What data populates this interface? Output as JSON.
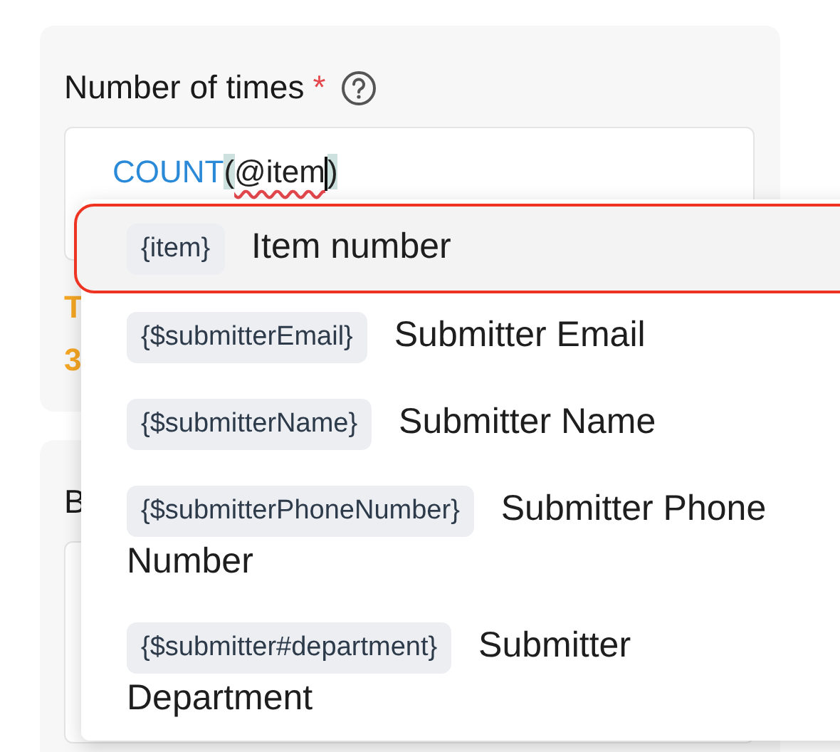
{
  "field": {
    "label": "Number of times",
    "required_mark": "*",
    "formula": [
      {
        "text": "COUNT",
        "kind": "function"
      },
      {
        "text": "(",
        "kind": "bracket"
      },
      {
        "text": "@item",
        "kind": "error"
      },
      {
        "text": ")",
        "kind": "bracket"
      }
    ],
    "hint_lines": [
      "T",
      "3"
    ]
  },
  "next_field": {
    "label": "B"
  },
  "suggestions": [
    {
      "token": "{item}",
      "label": "Item number",
      "selected": true
    },
    {
      "token": "{$submitterEmail}",
      "label": "Submitter Email",
      "selected": false
    },
    {
      "token": "{$submitterName}",
      "label": "Submitter Name",
      "selected": false
    },
    {
      "token": "{$submitterPhoneNumber}",
      "label": "Submitter Phone Number",
      "selected": false
    },
    {
      "token": "{$submitter#department}",
      "label": "Submitter Department",
      "selected": false
    }
  ]
}
